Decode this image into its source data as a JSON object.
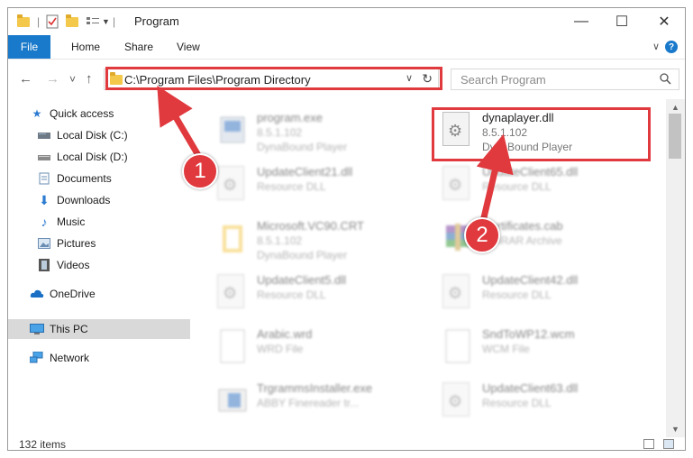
{
  "window": {
    "title": "Program",
    "minimize": "—",
    "maximize": "☐",
    "close": "✕"
  },
  "ribbon": {
    "file": "File",
    "home": "Home",
    "share": "Share",
    "view": "View",
    "help": "?"
  },
  "nav": {
    "back": "←",
    "forward": "→",
    "recent": "˅",
    "up": "↑",
    "address": "C:\\Program Files\\Program Directory",
    "search_placeholder": "Search Program"
  },
  "sidebar": {
    "items": [
      {
        "label": "Quick access",
        "icon": "star-icon"
      },
      {
        "label": "Local Disk (C:)",
        "icon": "drive-icon"
      },
      {
        "label": "Local Disk (D:)",
        "icon": "drive-icon"
      },
      {
        "label": "Documents",
        "icon": "documents-icon"
      },
      {
        "label": "Downloads",
        "icon": "download-icon"
      },
      {
        "label": "Music",
        "icon": "music-icon"
      },
      {
        "label": "Pictures",
        "icon": "pictures-icon"
      },
      {
        "label": "Videos",
        "icon": "videos-icon"
      },
      {
        "label": "OneDrive",
        "icon": "cloud-icon"
      },
      {
        "label": "This PC",
        "icon": "computer-icon"
      },
      {
        "label": "Network",
        "icon": "network-icon"
      }
    ]
  },
  "files": {
    "left": [
      {
        "name": "program.exe",
        "line2": "8.5.1.102",
        "line3": "DynaBound Player"
      },
      {
        "name": "UpdateClient21.dll",
        "line2": "Resource DLL",
        "line3": ""
      },
      {
        "name": "Microsoft.VC90.CRT",
        "line2": "8.5.1.102",
        "line3": "DynaBound Player"
      },
      {
        "name": "UpdateClient5.dll",
        "line2": "Resource DLL",
        "line3": ""
      },
      {
        "name": "Arabic.wrd",
        "line2": "WRD File",
        "line3": ""
      },
      {
        "name": "TrgrammsInstaller.exe",
        "line2": "ABBY Finereader tr...",
        "line3": ""
      }
    ],
    "right": [
      {
        "name": "dynaplayer.dll",
        "line2": "8.5.1.102",
        "line3": "DynaBound Player"
      },
      {
        "name": "UpdateClient65.dll",
        "line2": "Resource DLL",
        "line3": ""
      },
      {
        "name": "Certificates.cab",
        "line2": "WinRAR Archive",
        "line3": ""
      },
      {
        "name": "UpdateClient42.dll",
        "line2": "Resource DLL",
        "line3": ""
      },
      {
        "name": "SndToWP12.wcm",
        "line2": "WCM File",
        "line3": ""
      },
      {
        "name": "UpdateClient63.dll",
        "line2": "Resource DLL",
        "line3": ""
      }
    ]
  },
  "status": {
    "count": "132 items"
  },
  "callouts": {
    "one": "1",
    "two": "2"
  },
  "colors": {
    "accent": "#1979ca",
    "highlight": "#e0393e",
    "selected": "#d9d9d9"
  }
}
